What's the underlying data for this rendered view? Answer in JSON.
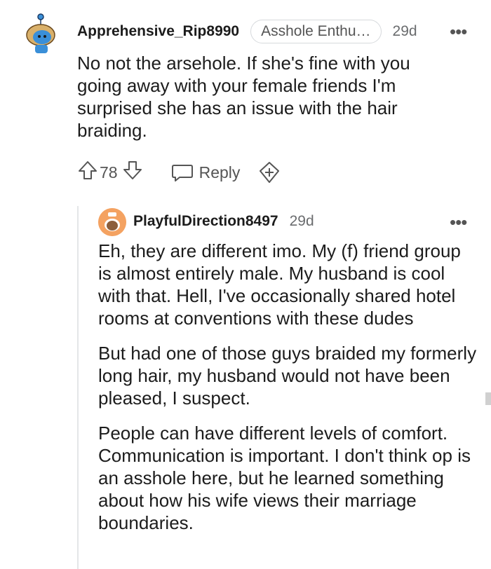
{
  "comments": [
    {
      "username": "Apprehensive_Rip8990",
      "flair": "Asshole Enthu…",
      "age": "29d",
      "more_glyph": "•••",
      "paragraphs": [
        "No not the arsehole. If she's fine with you going away with your female friends I'm surprised she has an issue with the hair braiding."
      ],
      "votes": "78",
      "reply_label": "Reply"
    },
    {
      "username": "PlayfulDirection8497",
      "age": "29d",
      "more_glyph": "•••",
      "paragraphs": [
        "Eh, they are different imo. My (f) friend group is almost entirely male. My husband is cool with that. Hell, I've occasionally shared hotel rooms at conventions with these dudes",
        "But had one of those guys braided my formerly long hair, my husband would not have been pleased, I suspect.",
        "People can have different levels of comfort. Communication is important. I don't think op is an asshole here, but he learned something about how his wife views their marriage boundaries."
      ]
    }
  ],
  "colors": {
    "text": "#1c1c1c",
    "muted": "#6a6c6e",
    "avatar1": "#3a8fd8",
    "avatar2": "#f4a261"
  }
}
